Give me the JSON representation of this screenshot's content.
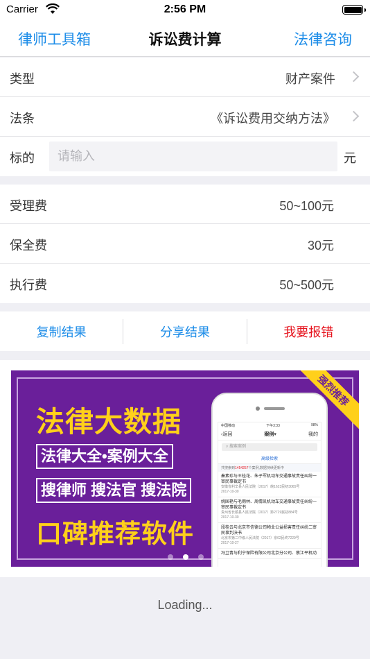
{
  "status_bar": {
    "carrier": "Carrier",
    "time": "2:56 PM"
  },
  "nav": {
    "left": "律师工具箱",
    "title": "诉讼费计算",
    "right": "法律咨询"
  },
  "form": {
    "type_label": "类型",
    "type_value": "财产案件",
    "law_label": "法条",
    "law_value": "《诉讼费用交纳方法》",
    "amount_label": "标的",
    "amount_placeholder": "请输入",
    "amount_value": "",
    "amount_unit": "元"
  },
  "results": [
    {
      "label": "受理费",
      "value": "50~100元"
    },
    {
      "label": "保全费",
      "value": "30元"
    },
    {
      "label": "执行费",
      "value": "50~500元"
    }
  ],
  "actions": {
    "copy": "复制结果",
    "share": "分享结果",
    "report": "我要报错"
  },
  "banner": {
    "headline": "法律大数据",
    "line1": "法律大全•案例大全",
    "line2": "搜律师 搜法官 搜法院",
    "headline2": "口碑推荐软件",
    "ribbon": "强烈推荐",
    "phone": {
      "carrier": "中国移动",
      "time": "下午3:33",
      "battery": "98%",
      "back": "返回",
      "title": "案例",
      "mine": "我的",
      "search_placeholder": "搜索案例",
      "advanced": "高级检索",
      "hint_prefix": "共搜索到",
      "hint_count": "1454257",
      "hint_suffix": "个案例,数据持续更新中",
      "items": [
        {
          "title": "秦素珍与王桂花、朱子军机动车交通事故责任纠纷一审民事裁定书",
          "court": "安徽省利辛县人民法院（2017）皖1623民初3065号",
          "date": "2017-10-30"
        },
        {
          "title": "姚国艳与毛雨林、周倩凯机动车交通事故责任纠纷一审民事裁定书",
          "court": "贵州省长顺县人民法院（2017）黔2729民初884号",
          "date": "2017-10-30"
        },
        {
          "title": "段桂云与北京市信德公司物业公益损害责任纠纷二审民事判决书",
          "court": "北京市第二中级人民法院（2017）京02民终7229号",
          "date": "2017-10-27"
        },
        {
          "title": "冯卫青与利宁保险有限公司北京分公司、蔡江平机动",
          "court": "",
          "date": ""
        }
      ]
    },
    "slides_total": 3,
    "slides_active": 2
  },
  "loading": "Loading..."
}
